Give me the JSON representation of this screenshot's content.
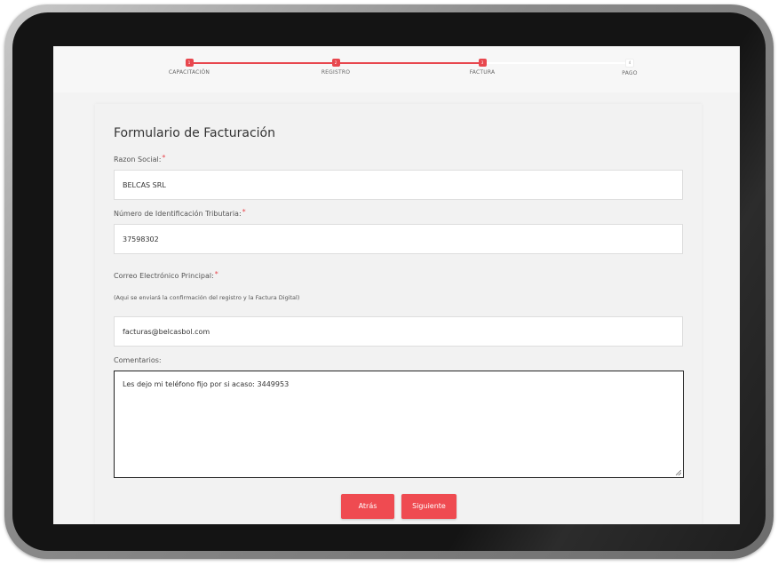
{
  "stepper": {
    "steps": [
      {
        "number": "1",
        "label": "CAPACITACIÓN"
      },
      {
        "number": "2",
        "label": "REGISTRO"
      },
      {
        "number": "3",
        "label": "FACTURA"
      },
      {
        "number": "4",
        "label": "PAGO"
      }
    ],
    "active_color": "#e8474e"
  },
  "form": {
    "title": "Formulario de Facturación",
    "razon_social": {
      "label": "Razon Social:",
      "required": "*",
      "value": "BELCAS SRL"
    },
    "nit": {
      "label": "Número de Identificación Tributaria:",
      "required": "*",
      "value": "37598302"
    },
    "email": {
      "label": "Correo Electrónico Principal:",
      "required": "*",
      "helper": "(Aqui se enviará la confirmación del registro y la Factura Digital)",
      "value": "facturas@belcasbol.com"
    },
    "comentarios": {
      "label": "Comentarios:",
      "value": "Les dejo mi teléfono fijo por si acaso: 3449953"
    },
    "buttons": {
      "back": "Atrás",
      "next": "Siguiente"
    },
    "button_color": "#ef4b51"
  }
}
